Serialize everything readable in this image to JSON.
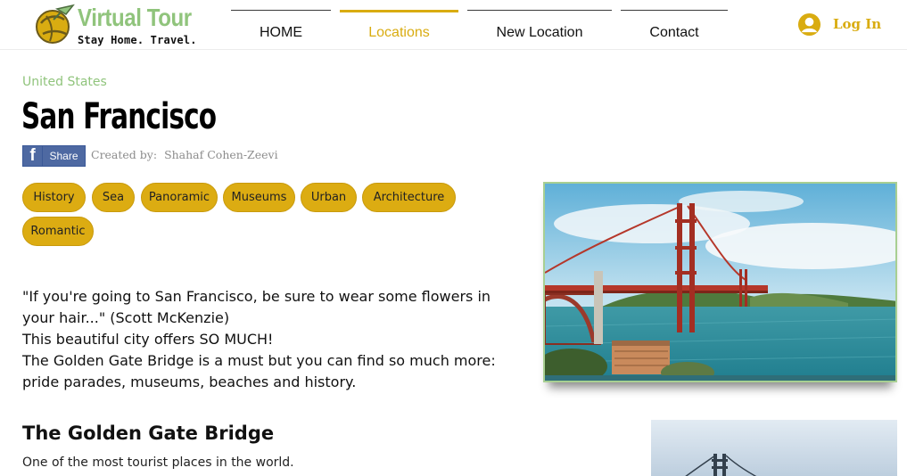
{
  "brand": {
    "title": "Virtual Tour",
    "tagline": "Stay Home. Travel."
  },
  "nav": {
    "items": [
      {
        "label": "HOME",
        "active": false
      },
      {
        "label": "Locations",
        "active": true
      },
      {
        "label": "New Location",
        "active": false
      },
      {
        "label": "Contact",
        "active": false
      }
    ]
  },
  "account": {
    "login_label": "Log In"
  },
  "location": {
    "country": "United States",
    "city": "San Francisco"
  },
  "share": {
    "icon_glyph": "f",
    "label": "Share"
  },
  "credit": {
    "prefix": "Created by:",
    "author": "Shahaf Cohen-Zeevi"
  },
  "tags": [
    "History",
    "Sea",
    "Panoramic",
    "Museums",
    "Urban",
    "Architecture",
    "Romantic"
  ],
  "description": {
    "lines": [
      "\"If you're going to San Francisco, be sure to wear some flowers in",
      "your hair...\" (Scott McKenzie)",
      "This beautiful city offers SO MUCH!",
      "The Golden Gate Bridge is a must but you can find so much more:",
      "pride parades, museums, beaches and history."
    ]
  },
  "section": {
    "title": "The Golden Gate Bridge",
    "body": "One of the most tourist places in the world."
  },
  "colors": {
    "accent": "#d9ac11",
    "brand_green": "#90c47c",
    "tag_bg": "#dcac12",
    "facebook": "#4e69a2"
  }
}
